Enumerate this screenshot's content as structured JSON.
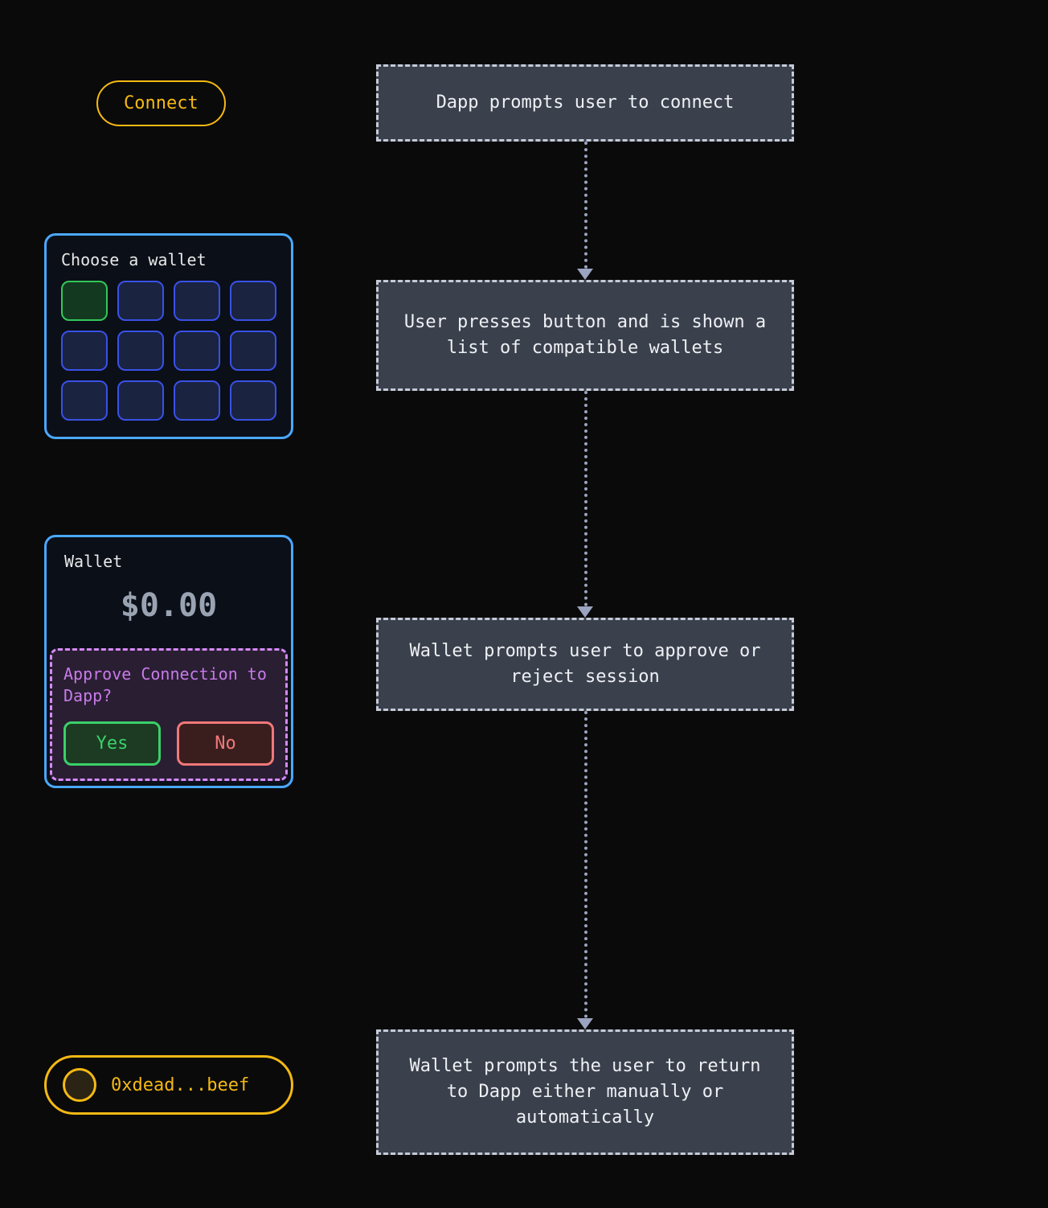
{
  "connect": {
    "label": "Connect"
  },
  "chooser": {
    "title": "Choose a wallet"
  },
  "wallet": {
    "label": "Wallet",
    "balance": "$0.00",
    "approve_question": "Approve Connection to Dapp?",
    "yes": "Yes",
    "no": "No"
  },
  "address": {
    "text": "0xdead...beef"
  },
  "flow": {
    "step1": "Dapp prompts user to connect",
    "step2": "User presses button and is shown a list of compatible wallets",
    "step3": "Wallet prompts user to approve or reject session",
    "step4": "Wallet prompts the user to return to Dapp either manually or automatically"
  },
  "colors": {
    "accent_yellow": "#f5b914",
    "accent_blue": "#4aa8ff",
    "accent_green": "#3bd06a",
    "accent_red": "#f17878",
    "accent_purple": "#d48af9"
  }
}
